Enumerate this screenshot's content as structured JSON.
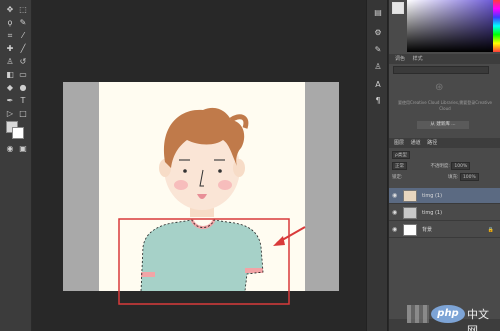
{
  "colors": {
    "ui_bg": "#282828",
    "toolbar_bg": "#3c3c3c",
    "panel_bg": "#4a4a4a",
    "canvas_gray": "#a9a9a9",
    "paper": "#fffcf1",
    "annotation_red": "#d93a3a",
    "selected_layer": "#5b6a82"
  },
  "toolbar": {
    "tools": [
      "move-tool",
      "marquee-tool",
      "lasso-tool",
      "quick-selection-tool",
      "crop-tool",
      "eyedropper-tool",
      "healing-brush-tool",
      "brush-tool",
      "clone-stamp-tool",
      "history-brush-tool",
      "eraser-tool",
      "gradient-tool",
      "blur-tool",
      "dodge-tool",
      "pen-tool",
      "type-tool",
      "path-selection-tool",
      "shape-tool",
      "hand-tool",
      "zoom-tool",
      "edit-toolbar",
      "quick-mask",
      "screen-mode"
    ]
  },
  "panel": {
    "tabs": [
      "调色",
      "样式"
    ],
    "libraries_text": "要使用Creative Cloud Libraries,需要登录Creative Cloud",
    "libraries_button": "从 建新库 ..."
  },
  "layers_panel": {
    "tabs": [
      "图层",
      "通道",
      "路径"
    ],
    "filter_label": "ρ类型",
    "blend_mode": "正常",
    "opacity_label": "不透明度:",
    "opacity_value": "100%",
    "lock_label": "锁定:",
    "fill_label": "填充:",
    "fill_value": "100%",
    "layers": [
      {
        "name": "timg (1)",
        "selected": true
      },
      {
        "name": "timg (1)",
        "selected": false
      },
      {
        "name": "背景",
        "selected": false
      }
    ]
  },
  "watermark": {
    "logo": "php",
    "text": "中文网"
  }
}
